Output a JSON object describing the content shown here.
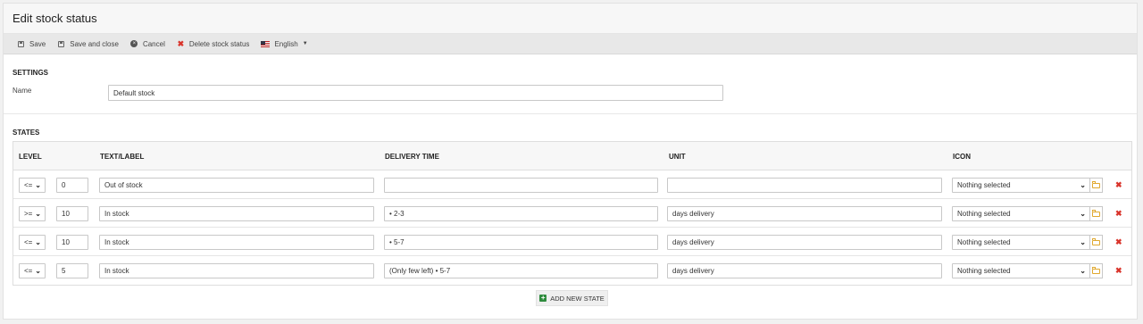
{
  "page": {
    "title": "Edit stock status"
  },
  "toolbar": {
    "save": "Save",
    "save_close": "Save and close",
    "cancel": "Cancel",
    "delete": "Delete stock status",
    "language": "English"
  },
  "settings": {
    "heading": "SETTINGS",
    "name_label": "Name",
    "name_value": "Default stock"
  },
  "states": {
    "heading": "STATES",
    "columns": {
      "level": "LEVEL",
      "text": "TEXT/LABEL",
      "delivery": "DELIVERY TIME",
      "unit": "UNIT",
      "icon": "ICON"
    },
    "rows": [
      {
        "op": "<=",
        "level": "0",
        "text": "Out of stock",
        "delivery": "",
        "unit": "",
        "icon": "Nothing selected"
      },
      {
        "op": ">=",
        "level": "10",
        "text": "In stock",
        "delivery": "• 2-3",
        "unit": "days delivery",
        "icon": "Nothing selected"
      },
      {
        "op": "<=",
        "level": "10",
        "text": "In stock",
        "delivery": "• 5-7",
        "unit": "days delivery",
        "icon": "Nothing selected"
      },
      {
        "op": "<=",
        "level": "5",
        "text": "In stock",
        "delivery": "(Only few left) • 5-7",
        "unit": "days delivery",
        "icon": "Nothing selected"
      }
    ],
    "add_button": "ADD NEW STATE"
  },
  "icons": {
    "save": "save-icon",
    "cancel": "cancel-icon",
    "delete": "delete-icon",
    "flag": "us-flag-icon",
    "folder": "folder-icon",
    "remove": "remove-icon",
    "add": "plus-icon"
  },
  "colors": {
    "delete_red": "#d9342b",
    "folder_orange": "#e0a82e",
    "add_green": "#2e8b3d"
  }
}
